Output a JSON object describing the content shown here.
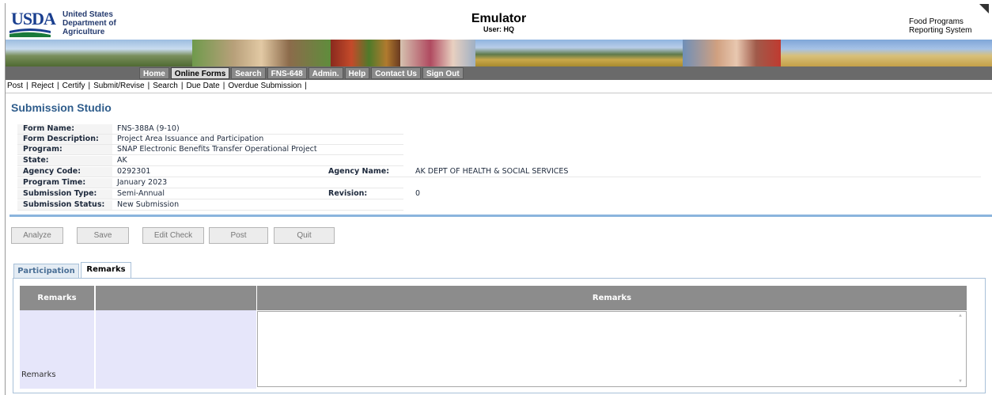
{
  "header": {
    "logo_text": "USDA",
    "dept_lines": [
      "United States",
      "Department of",
      "Agriculture"
    ],
    "app_title": "Emulator",
    "user": "User: HQ",
    "system_lines": [
      "Food Programs",
      "Reporting System"
    ]
  },
  "nav": {
    "items": [
      "Home",
      "Online Forms",
      "Search",
      "FNS-648",
      "Admin.",
      "Help",
      "Contact Us",
      "Sign Out"
    ],
    "active": "Online Forms"
  },
  "subnav": {
    "items": [
      "Post",
      "Reject",
      "Certify",
      "Submit/Revise",
      "Search",
      "Due Date",
      "Overdue Submission"
    ]
  },
  "page_title": "Submission Studio",
  "form": {
    "form_name_label": "Form Name:",
    "form_name": "FNS-388A (9-10)",
    "form_description_label": "Form Description:",
    "form_description": "Project Area Issuance and Participation",
    "program_label": "Program:",
    "program": "SNAP Electronic Benefits Transfer Operational Project",
    "state_label": "State:",
    "state": "AK",
    "agency_code_label": "Agency Code:",
    "agency_code": "0292301",
    "agency_name_label": "Agency Name:",
    "agency_name": "AK DEPT OF HEALTH & SOCIAL SERVICES",
    "program_time_label": "Program Time:",
    "program_time": "January 2023",
    "submission_type_label": "Submission Type:",
    "submission_type": "Semi-Annual",
    "revision_label": "Revision:",
    "revision": "0",
    "submission_status_label": "Submission Status:",
    "submission_status": "New Submission"
  },
  "actions": {
    "analyze": "Analyze",
    "save": "Save",
    "edit_check": "Edit Check",
    "post": "Post",
    "quit": "Quit"
  },
  "tabs": {
    "participation": "Participation",
    "remarks": "Remarks",
    "active": "Remarks"
  },
  "grid": {
    "col1_header": "Remarks",
    "col2_header": "",
    "col3_header": "Remarks",
    "row_label": "Remarks",
    "remarks_value": ""
  },
  "colors": {
    "title_blue": "#2f5d8c",
    "nav_gray": "#6a6a6a",
    "divider_blue": "#8ab4dd",
    "grid_header": "#8c8c8c",
    "row_lavender": "#e6e6fa"
  }
}
